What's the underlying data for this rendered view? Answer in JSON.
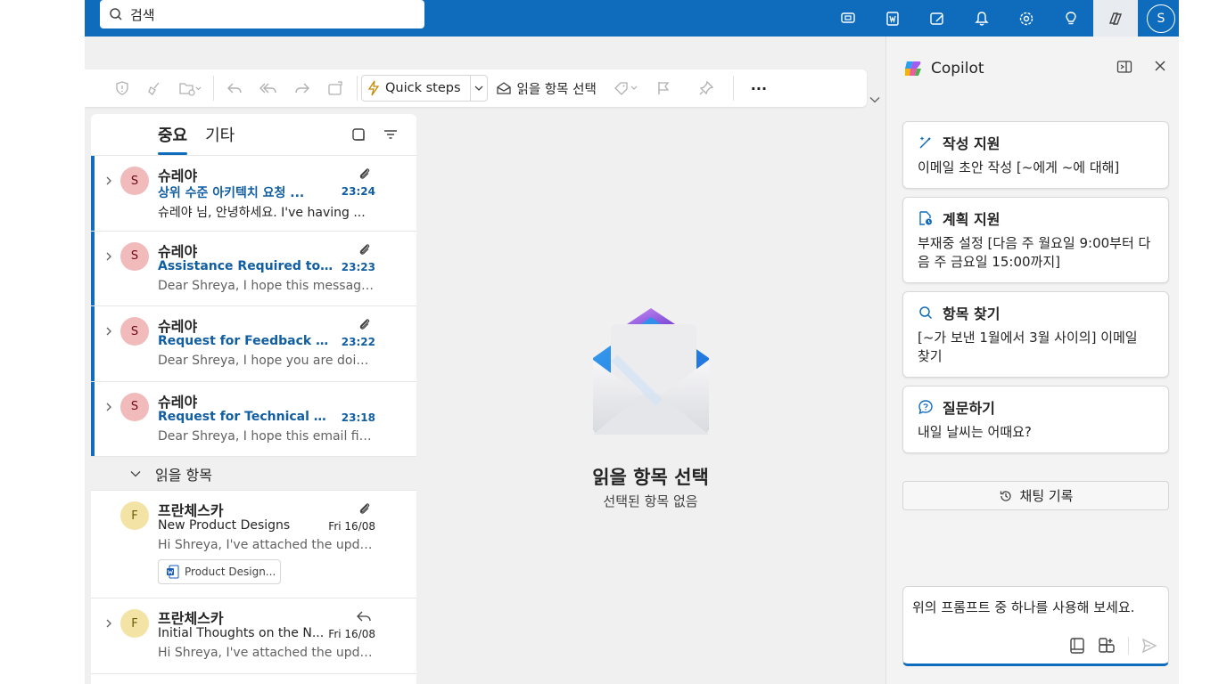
{
  "search": {
    "placeholder": "검색"
  },
  "user": {
    "initial": "S"
  },
  "ribbon": {
    "quick_steps": "Quick steps",
    "read_select": "읽을 항목 선택",
    "more": "···"
  },
  "tabs": {
    "focused": "중요",
    "other": "기타"
  },
  "emails_unread": [
    {
      "sender": "슈레야",
      "initial": "S",
      "subject": "상위 수준 아키텍치 요청 ...",
      "time": "23:24",
      "preview": "슈레야 님, 안녕하세요. I've having ..."
    },
    {
      "sender": "슈레야",
      "initial": "S",
      "subject": "Assistance Required to Ove...",
      "time": "23:23",
      "preview": "Dear Shreya, I hope this message fin..."
    },
    {
      "sender": "슈레야",
      "initial": "S",
      "subject": "Request for Feedback on Pr...",
      "time": "23:22",
      "preview": "Dear Shreya, I hope you are doing w..."
    },
    {
      "sender": "슈레야",
      "initial": "S",
      "subject": "Request for Technical Guida...",
      "time": "23:18",
      "preview": "Dear Shreya, I hope this email finds ..."
    }
  ],
  "section_read": "읽을 항목",
  "emails_read": [
    {
      "sender": "프란체스카",
      "initial": "F",
      "subject": "New Product Designs",
      "time": "Fri 16/08",
      "preview": "Hi Shreya, I've attached the updated...",
      "attachment": "Product Design..."
    },
    {
      "sender": "프란체스카",
      "initial": "F",
      "subject": "Initial Thoughts on the N...",
      "time": "Fri 16/08",
      "preview": "Hi Shreya, I've attached the updated..."
    }
  ],
  "reading": {
    "title": "읽을 항목 선택",
    "subtitle": "선택된 항목 없음"
  },
  "copilot": {
    "title": "Copilot",
    "cards": [
      {
        "title": "작성 지원",
        "text": "이메일 초안 작성 [~에게 ~에 대해]"
      },
      {
        "title": "계획 지원",
        "text": "부재중 설정 [다음 주 월요일 9:00부터 다음 주 금요일 15:00까지]"
      },
      {
        "title": "항목 찾기",
        "text": "[~가 보낸 1월에서 3월 사이의] 이메일 찾기"
      },
      {
        "title": "질문하기",
        "text": "내일 날씨는 어때요?"
      }
    ],
    "history": "채팅 기록",
    "compose_prompt": "위의 프롬프트 중 하나를 사용해 보세요."
  },
  "colors": {
    "brand": "#0f6cbd",
    "unread_accent": "#115ea3"
  }
}
